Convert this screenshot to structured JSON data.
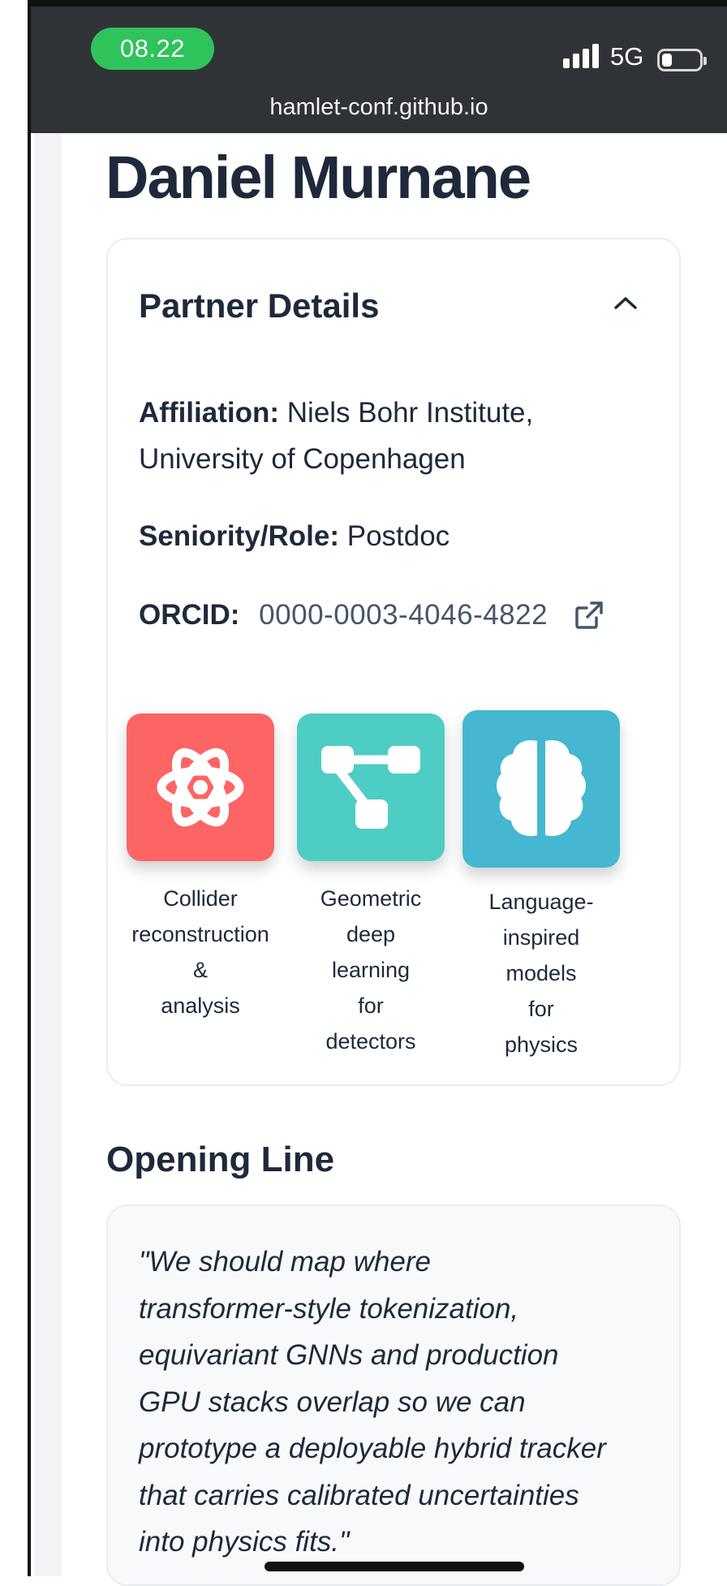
{
  "status_bar": {
    "time": "08.22",
    "network": "5G",
    "url": "hamlet-conf.github.io"
  },
  "page": {
    "title": "Daniel Murnane"
  },
  "partner_details": {
    "heading": "Partner Details",
    "affiliation_label": "Affiliation:",
    "affiliation_line1": "Niels Bohr Institute,",
    "affiliation_line2": "University of Copenhagen",
    "role_label": "Seniority/Role:",
    "role_value": "Postdoc",
    "orcid_label": "ORCID:",
    "orcid_value": "0000-0003-4046-4822"
  },
  "topics": [
    {
      "lines": [
        "Collider",
        "reconstruction",
        "&",
        "analysis"
      ],
      "icon": "atom-icon",
      "color": "#fd6464"
    },
    {
      "lines": [
        "Geometric",
        "deep",
        "learning",
        "for",
        "detectors"
      ],
      "icon": "graph-network-icon",
      "color": "#4ecdc4"
    },
    {
      "lines": [
        "Language-",
        "inspired",
        "models",
        "for",
        "physics"
      ],
      "icon": "brain-icon",
      "color": "#45b7d1"
    }
  ],
  "opening_line": {
    "heading": "Opening Line",
    "quote_lines": [
      "\"We should map where",
      "transformer-style tokenization,",
      "equivariant GNNs and production",
      "GPU stacks overlap so we can",
      "prototype a deployable hybrid tracker",
      "that carries calibrated uncertainties",
      "into physics fits.\""
    ]
  }
}
